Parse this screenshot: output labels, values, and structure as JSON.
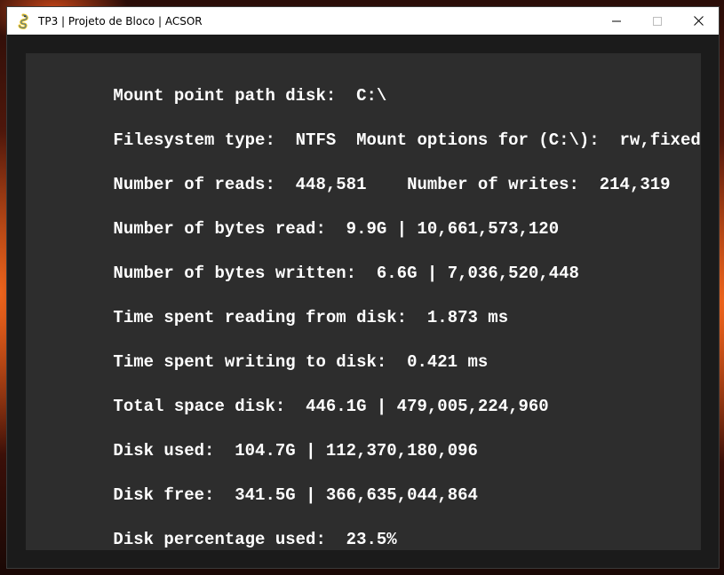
{
  "window": {
    "title": "TP3 | Projeto de Bloco | ACSOR",
    "icon": "pygame-snake-icon",
    "controls": {
      "minimize": "minimize-icon",
      "maximize": "maximize-icon",
      "close": "close-icon"
    }
  },
  "disk_info": {
    "mount_point": {
      "label": "Mount point path disk:  ",
      "value": "C:\\"
    },
    "fs_type": {
      "label": "Filesystem type:  ",
      "value": "NTFS"
    },
    "mount_options": {
      "label": "  Mount options for (C:\\):  ",
      "value": "rw,fixed"
    },
    "reads": {
      "label": "Number of reads:  ",
      "value": "448,581"
    },
    "writes": {
      "label": "    Number of writes:  ",
      "value": "214,319"
    },
    "bytes_read": {
      "label": "Number of bytes read:  ",
      "value": "9.9G | 10,661,573,120"
    },
    "bytes_written": {
      "label": "Number of bytes written:  ",
      "value": "6.6G | 7,036,520,448"
    },
    "time_reading": {
      "label": "Time spent reading from disk:  ",
      "value": "1.873 ms"
    },
    "time_writing": {
      "label": "Time spent writing to disk:  ",
      "value": "0.421 ms"
    },
    "total_space": {
      "label": "Total space disk:  ",
      "value": "446.1G | 479,005,224,960"
    },
    "disk_used": {
      "label": "Disk used:  ",
      "value": "104.7G | 112,370,180,096"
    },
    "disk_free": {
      "label": "Disk free:  ",
      "value": "341.5G | 366,635,044,864"
    },
    "percentage_used": {
      "label": "Disk percentage used:  ",
      "value": "23.5%"
    }
  },
  "colors": {
    "titlebar": "#ffffff",
    "panel_background": "#2d2d2d",
    "window_background": "#1b1b1b",
    "text": "#ffffff"
  }
}
